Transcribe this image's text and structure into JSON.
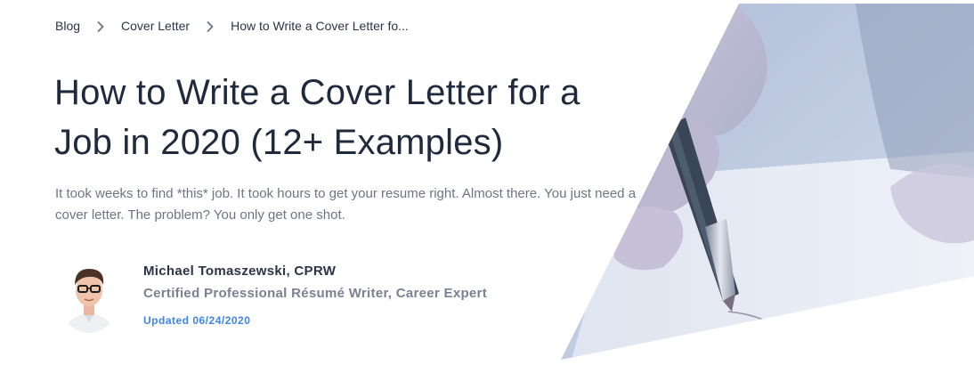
{
  "breadcrumb": {
    "items": [
      "Blog",
      "Cover Letter",
      "How to Write a Cover Letter fo..."
    ]
  },
  "article": {
    "title_line1": "How to Write a Cover Letter for a",
    "title_line2": "Job in 2020 (12+ Examples)",
    "lead": "It took weeks to find *this* job. It took hours to get your resume right. Almost there. You just need a cover letter. The problem? You only get one shot."
  },
  "author": {
    "name": "Michael Tomaszewski, CPRW",
    "role": "Certified Professional Résumé Writer, Career Expert",
    "updated": "Updated 06/24/2020"
  },
  "colors": {
    "title": "#1f2a3c",
    "body_text": "#6d7584",
    "link_blue": "#3d86e6",
    "hero_tint": "#b9c6de"
  },
  "icons": {
    "breadcrumb_separator": "chevron-right-icon"
  }
}
